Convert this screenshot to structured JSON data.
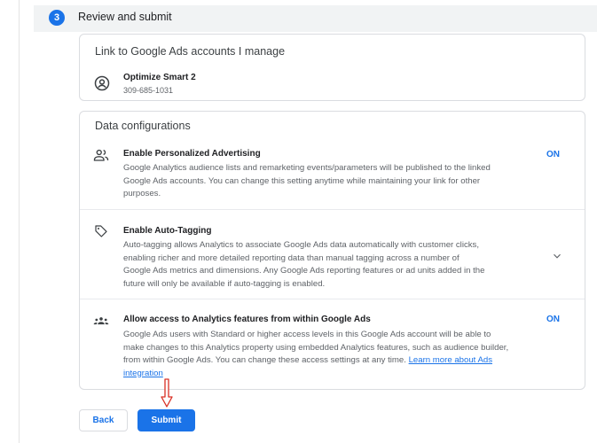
{
  "step": {
    "number": "3",
    "title": "Review and submit"
  },
  "ads_link": {
    "title": "Link to Google Ads accounts I manage",
    "account_name": "Optimize Smart 2",
    "account_id": "309-685-1031",
    "icon": "account-circle-icon"
  },
  "data_config": {
    "title": "Data configurations",
    "settings": [
      {
        "icon": "people-icon",
        "title": "Enable Personalized Advertising",
        "description": "Google Analytics audience lists and remarketing events/parameters will be published to the linked Google Ads accounts. You can change this setting anytime while maintaining your link for other purposes.",
        "status": "ON"
      },
      {
        "icon": "tag-icon",
        "title": "Enable Auto-Tagging",
        "description": "Auto-tagging allows Analytics to associate Google Ads data automatically with customer clicks, enabling richer and more detailed reporting data than manual tagging across a number of Google Ads metrics and dimensions. Any Google Ads reporting features or ad units added in the future will only be available if auto-tagging is enabled.",
        "status": ""
      },
      {
        "icon": "groups-icon",
        "title": "Allow access to Analytics features from within Google Ads",
        "description": "Google Ads users with Standard or higher access levels in this Google Ads account will be able to make changes to this Analytics property using embedded Analytics features, such as audience builder, from within Google Ads. You can change these access settings at any time.",
        "link_text": "Learn more about Ads integration",
        "status": "ON"
      }
    ]
  },
  "buttons": {
    "back": "Back",
    "submit": "Submit"
  },
  "colors": {
    "accent": "#1a73e8",
    "annotation_arrow": "#d93025"
  }
}
